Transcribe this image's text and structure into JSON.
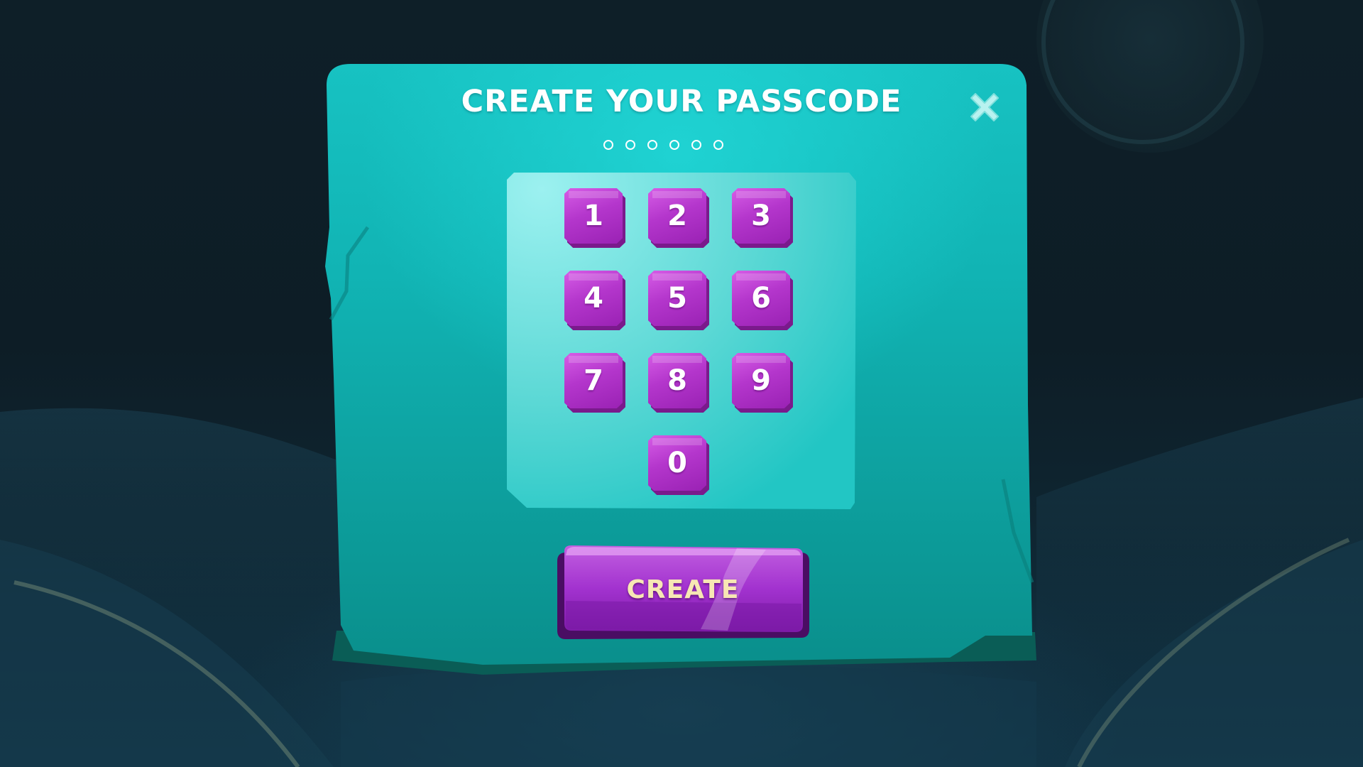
{
  "dialog": {
    "title": "CREATE YOUR PASSCODE",
    "close_icon": "close-x-icon",
    "passcode_length": 6,
    "entered_digits": 0
  },
  "keypad": {
    "keys": [
      "1",
      "2",
      "3",
      "4",
      "5",
      "6",
      "7",
      "8",
      "9",
      "0"
    ]
  },
  "actions": {
    "create_label": "CREATE"
  },
  "colors": {
    "panel": "#16c2c2",
    "panel_edge": "#0a6e66",
    "keypad_panel": "#6ee3e0",
    "key_face": "#b436cc",
    "key_shadow": "#7a1a8c",
    "button": "#9b27c4",
    "button_label": "#f7e7b4"
  }
}
